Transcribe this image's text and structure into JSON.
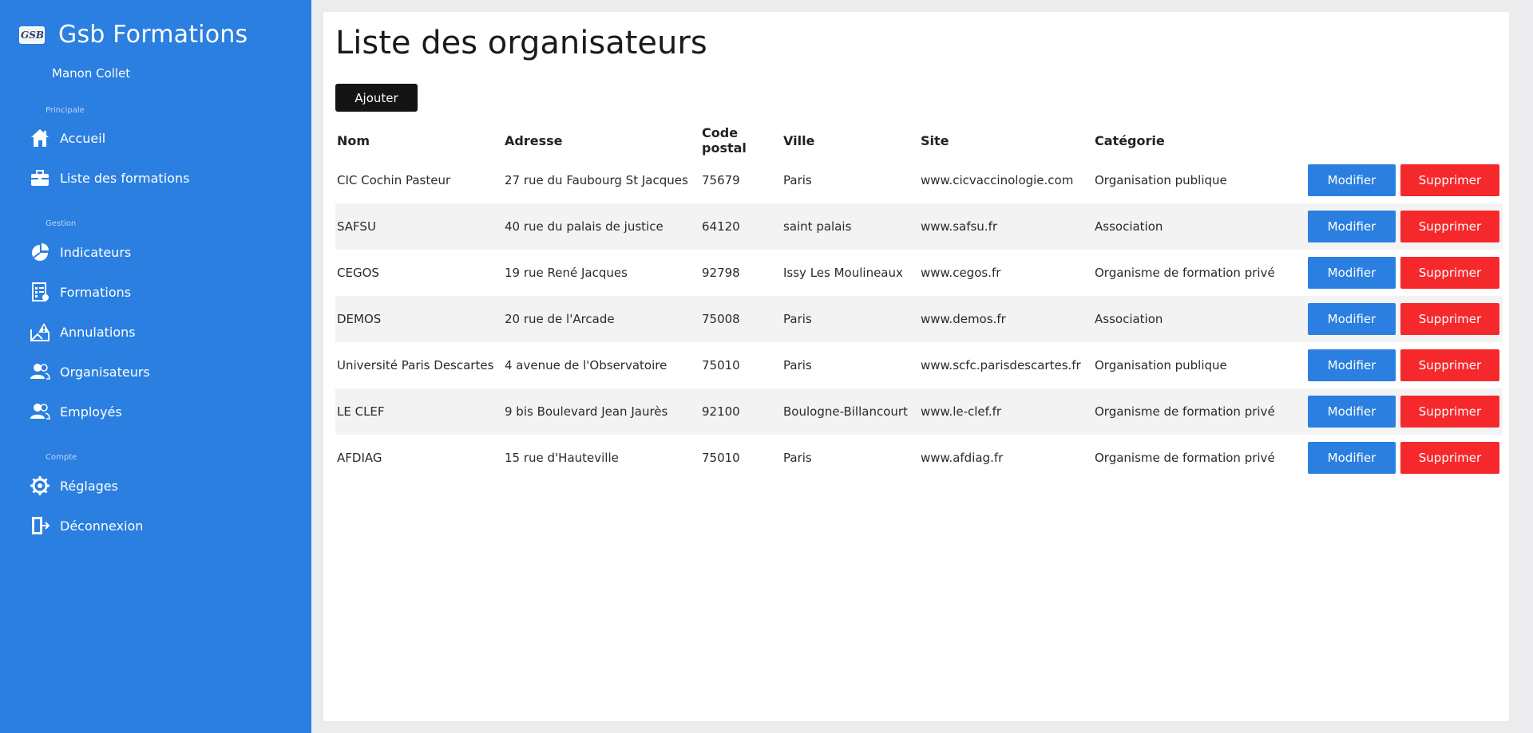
{
  "app": {
    "logo_text": "GSB",
    "title": "Gsb Formations",
    "user": "Manon Collet"
  },
  "sidebar": {
    "sections": {
      "principale": "Principale",
      "gestion": "Gestion",
      "compte": "Compte"
    },
    "items": [
      {
        "label": "Accueil",
        "icon": "home-icon"
      },
      {
        "label": "Liste des formations",
        "icon": "briefcase-icon"
      },
      {
        "label": "Indicateurs",
        "icon": "pie-chart-icon"
      },
      {
        "label": "Formations",
        "icon": "checklist-icon"
      },
      {
        "label": "Annulations",
        "icon": "alert-icon"
      },
      {
        "label": "Organisateurs",
        "icon": "users-icon"
      },
      {
        "label": "Employés",
        "icon": "users-icon"
      },
      {
        "label": "Réglages",
        "icon": "gear-icon"
      },
      {
        "label": "Déconnexion",
        "icon": "logout-icon"
      }
    ]
  },
  "main": {
    "title": "Liste des organisateurs",
    "add_label": "Ajouter",
    "columns": [
      "Nom",
      "Adresse",
      "Code postal",
      "Ville",
      "Site",
      "Catégorie"
    ],
    "edit_label": "Modifier",
    "delete_label": "Supprimer",
    "rows": [
      [
        "CIC Cochin Pasteur",
        "27 rue du Faubourg St Jacques",
        "75679",
        "Paris",
        "www.cicvaccinologie.com",
        "Organisation publique"
      ],
      [
        "SAFSU",
        "40 rue du palais de justice",
        "64120",
        "saint palais",
        "www.safsu.fr",
        "Association"
      ],
      [
        "CEGOS",
        "19 rue René Jacques",
        "92798",
        "Issy Les Moulineaux",
        "www.cegos.fr",
        "Organisme de formation privé"
      ],
      [
        "DEMOS",
        "20 rue de l'Arcade",
        "75008",
        "Paris",
        "www.demos.fr",
        "Association"
      ],
      [
        "Université Paris Descartes",
        "4 avenue de l'Observatoire",
        "75010",
        "Paris",
        "www.scfc.parisdescartes.fr",
        "Organisation publique"
      ],
      [
        "LE CLEF",
        "9 bis Boulevard Jean Jaurès",
        "92100",
        "Boulogne-Billancourt",
        "www.le-clef.fr",
        "Organisme de formation privé"
      ],
      [
        "AFDIAG",
        "15 rue d'Hauteville",
        "75010",
        "Paris",
        "www.afdiag.fr",
        "Organisme de formation privé"
      ]
    ]
  },
  "colors": {
    "sidebar": "#2a7fe0",
    "edit_button": "#2a7fe0",
    "delete_button": "#f5282c",
    "add_button": "#141414"
  }
}
